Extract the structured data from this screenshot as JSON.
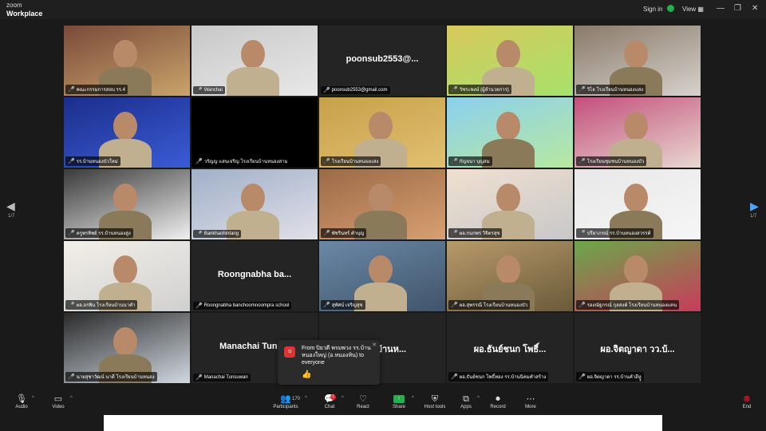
{
  "app": {
    "brand_top": "zoom",
    "brand_bottom": "Workplace"
  },
  "topbar": {
    "sign_in": "Sign in",
    "view": "View"
  },
  "colors": {
    "accent_green": "#23b14d",
    "active_speaker": "#2ecc71",
    "mute_red": "#e22233"
  },
  "page": {
    "left": "1/7",
    "right": "1/7"
  },
  "tiles": [
    {
      "label": "คณะกรรมการสอบ รร.4",
      "center": "",
      "video": true
    },
    {
      "label": "Wanchai",
      "center": "",
      "video": true
    },
    {
      "label": "poonsub2553@gmail.com",
      "center": "poonsub2553@...",
      "video": false
    },
    {
      "label": "วัชระพงษ์ (ผู้อำนวยการ)",
      "center": "",
      "video": true
    },
    {
      "label": "วิไล โรงเรียนบ้านหนองแสง",
      "center": "",
      "video": true
    },
    {
      "label": "รร.บ้านหนองบัวใหม่",
      "center": "",
      "video": true
    },
    {
      "label": "วรัญญ แสนเจริญ โรงเรียนบ้านหนองสาม",
      "center": "",
      "video": false
    },
    {
      "label": "โรงเรียนบ้านหนองแสง",
      "center": "",
      "video": true
    },
    {
      "label": "กัญจนา บุญสม",
      "center": "",
      "video": true
    },
    {
      "label": "โรงเรียนชุมชนบ้านหนองบัว",
      "center": "",
      "video": true
    },
    {
      "label": "ครูพรทิพย์ รร.บ้านหนองสูง",
      "center": "",
      "video": true
    },
    {
      "label": "Bankhaohintang",
      "center": "",
      "video": true
    },
    {
      "label": "พัชรินทร์ คำบุญ",
      "center": "",
      "video": true
    },
    {
      "label": "ผอ.กนกพร วิจิตรสุข",
      "center": "",
      "video": true
    },
    {
      "label": "ปรียาภรณ์ รร.บ้านหนองสวรรค์",
      "center": "",
      "video": true
    },
    {
      "label": "ผอ.อรพิน โรงเรียนบ้านนาคำ",
      "center": "",
      "video": true
    },
    {
      "label": "Roongnabha banchoomnoompra school",
      "center": "Roongnabha ba...",
      "video": false
    },
    {
      "label": "สุทัศน์ เจริญสุข",
      "center": "",
      "video": true
    },
    {
      "label": "ผอ.สุพรรณี โรงเรียนบ้านหนองบัว",
      "center": "",
      "video": true
    },
    {
      "label": "รองณัฐกรณ์ กุลสงค์ โรงเรียนบ้านหนองแคน",
      "center": "",
      "video": true
    },
    {
      "label": "นายสุชาวัฒน์ นาดี โรงเรียนบ้านหนอง",
      "center": "",
      "video": true
    },
    {
      "label": "Manachai Tunsuwan",
      "center": "Manachai Tuns...",
      "video": false
    },
    {
      "label": "",
      "center": "...ยนบ้านห...",
      "video": false
    },
    {
      "label": "ผอ.ธันย์ชนก โพธิ์ทอง รร.บ้านนิคมคำสร้าง",
      "center": "ผอ.ธันย์ชนก โพธิ์...",
      "video": false
    },
    {
      "label": "ผอ.จิตญาดา รร.บ้านคำอีหูู",
      "center": "ผอ.จิตญาดา วว.บ้...",
      "video": false
    }
  ],
  "chat_toast": {
    "avatar": "ป",
    "message": "From ปิยวดี พรมพวง รร.บ้านหนองใหญ่ (อ.หนองหิน) to everyone",
    "emoji": "👍"
  },
  "toolbar": {
    "audio": "Audio",
    "video": "Video",
    "participants": "Participants",
    "participants_count": "170",
    "chat": "Chat",
    "chat_badge": "1",
    "react": "React",
    "share": "Share",
    "host_tools": "Host tools",
    "apps": "Apps",
    "record": "Record",
    "more": "More",
    "end": "End"
  }
}
